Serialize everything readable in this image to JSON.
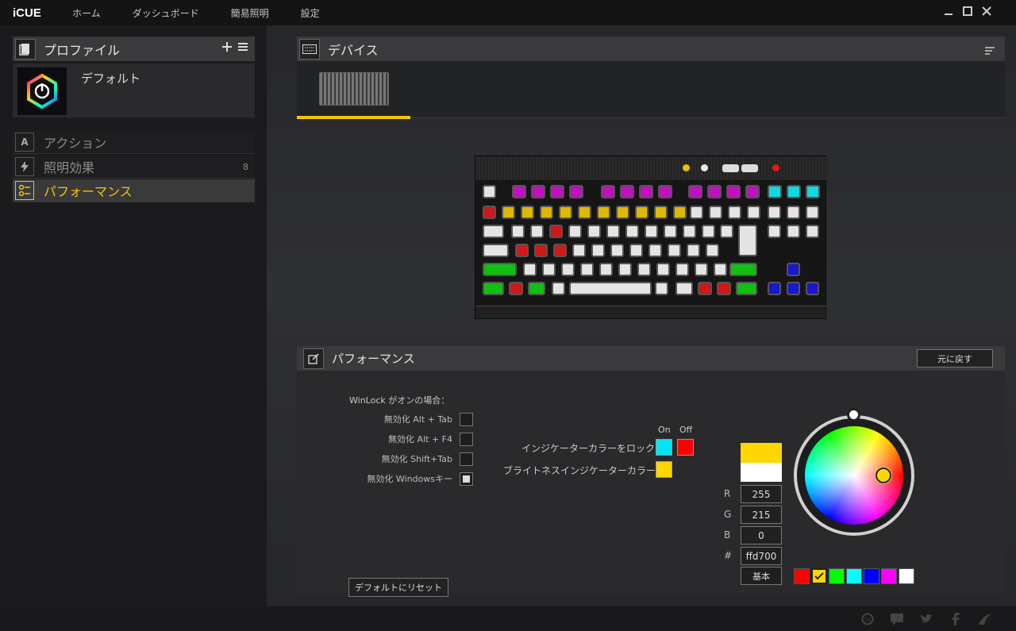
{
  "app": {
    "logo": "iCUE"
  },
  "topnav": [
    "ホーム",
    "ダッシュボード",
    "簡易照明",
    "設定"
  ],
  "profiles": {
    "title": "プロファイル",
    "name": "デフォルト"
  },
  "sidebar": {
    "items": [
      {
        "icon": "A",
        "label": "アクション",
        "count": ""
      },
      {
        "icon": "bolt-icon",
        "label": "照明効果",
        "count": "8"
      },
      {
        "icon": "performance-icon",
        "label": "パフォーマンス",
        "count": ""
      }
    ]
  },
  "devices": {
    "title": "デバイス"
  },
  "performance": {
    "title": "パフォーマンス",
    "revert": "元に戻す",
    "winlock_title": "WinLock がオンの場合：",
    "options": [
      {
        "label": "無効化 Alt + Tab",
        "checked": false
      },
      {
        "label": "無効化 Alt + F4",
        "checked": false
      },
      {
        "label": "無効化 Shift+Tab",
        "checked": false
      },
      {
        "label": "無効化 Windowsキー",
        "checked": true
      }
    ],
    "on": "On",
    "off": "Off",
    "lock_label": "インジケーターカラーをロック",
    "brightness_label": "ブライトネスインジケーターカラー",
    "lock_on_color": "#00e5f0",
    "lock_off_color": "#ff0000",
    "brightness_color": "#ffd700",
    "reset": "デフォルトにリセット"
  },
  "color": {
    "r_label": "R",
    "g_label": "G",
    "b_label": "B",
    "hex_label": "#",
    "r": "255",
    "g": "215",
    "b": "0",
    "hex": "ffd700",
    "basic": "基本",
    "palette": [
      "#ff0000",
      "#ffd700",
      "#00ff00",
      "#00ffff",
      "#0000ff",
      "#ff00ff",
      "#ffffff"
    ]
  }
}
